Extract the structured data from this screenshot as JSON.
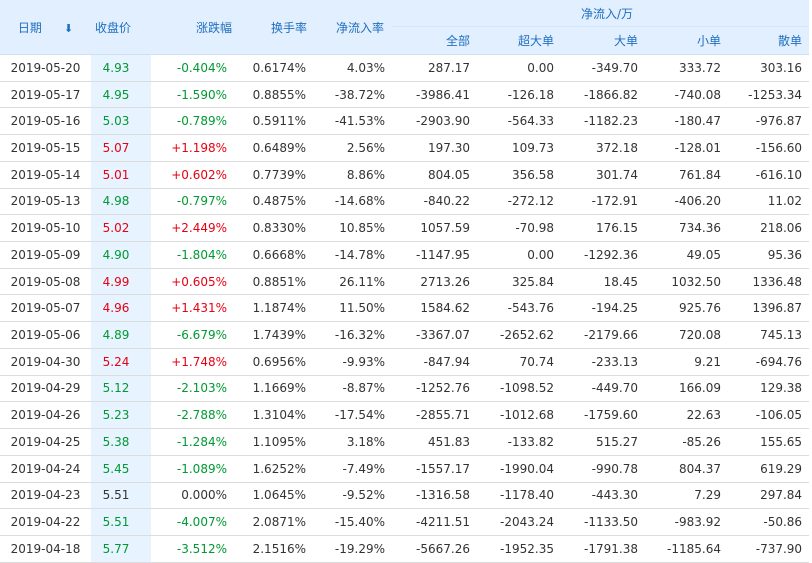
{
  "headers": {
    "date": "日期",
    "close": "收盘价",
    "change_pct": "涨跌幅",
    "turnover": "换手率",
    "net_inflow_rate": "净流入率",
    "net_inflow_group": "净流入/万",
    "all": "全部",
    "super_large": "超大单",
    "large": "大单",
    "small": "小单",
    "retail": "散单"
  },
  "colors": {
    "up": "#e60012",
    "down": "#009933",
    "flat": "#333333",
    "header_bg": "#e2efff",
    "header_text": "#1f6fbf",
    "close_col_bg": "#e7f3ff"
  },
  "sort_icon": "arrow-down-icon",
  "rows": [
    {
      "date": "2019-05-20",
      "close": "4.93",
      "change": "-0.404%",
      "turnover": "0.6174%",
      "rate": "4.03%",
      "all": "287.17",
      "super": "0.00",
      "large": "-349.70",
      "small": "333.72",
      "retail": "303.16",
      "dir": "down"
    },
    {
      "date": "2019-05-17",
      "close": "4.95",
      "change": "-1.590%",
      "turnover": "0.8855%",
      "rate": "-38.72%",
      "all": "-3986.41",
      "super": "-126.18",
      "large": "-1866.82",
      "small": "-740.08",
      "retail": "-1253.34",
      "dir": "down"
    },
    {
      "date": "2019-05-16",
      "close": "5.03",
      "change": "-0.789%",
      "turnover": "0.5911%",
      "rate": "-41.53%",
      "all": "-2903.90",
      "super": "-564.33",
      "large": "-1182.23",
      "small": "-180.47",
      "retail": "-976.87",
      "dir": "down"
    },
    {
      "date": "2019-05-15",
      "close": "5.07",
      "change": "+1.198%",
      "turnover": "0.6489%",
      "rate": "2.56%",
      "all": "197.30",
      "super": "109.73",
      "large": "372.18",
      "small": "-128.01",
      "retail": "-156.60",
      "dir": "up"
    },
    {
      "date": "2019-05-14",
      "close": "5.01",
      "change": "+0.602%",
      "turnover": "0.7739%",
      "rate": "8.86%",
      "all": "804.05",
      "super": "356.58",
      "large": "301.74",
      "small": "761.84",
      "retail": "-616.10",
      "dir": "up"
    },
    {
      "date": "2019-05-13",
      "close": "4.98",
      "change": "-0.797%",
      "turnover": "0.4875%",
      "rate": "-14.68%",
      "all": "-840.22",
      "super": "-272.12",
      "large": "-172.91",
      "small": "-406.20",
      "retail": "11.02",
      "dir": "down"
    },
    {
      "date": "2019-05-10",
      "close": "5.02",
      "change": "+2.449%",
      "turnover": "0.8330%",
      "rate": "10.85%",
      "all": "1057.59",
      "super": "-70.98",
      "large": "176.15",
      "small": "734.36",
      "retail": "218.06",
      "dir": "up"
    },
    {
      "date": "2019-05-09",
      "close": "4.90",
      "change": "-1.804%",
      "turnover": "0.6668%",
      "rate": "-14.78%",
      "all": "-1147.95",
      "super": "0.00",
      "large": "-1292.36",
      "small": "49.05",
      "retail": "95.36",
      "dir": "down"
    },
    {
      "date": "2019-05-08",
      "close": "4.99",
      "change": "+0.605%",
      "turnover": "0.8851%",
      "rate": "26.11%",
      "all": "2713.26",
      "super": "325.84",
      "large": "18.45",
      "small": "1032.50",
      "retail": "1336.48",
      "dir": "up"
    },
    {
      "date": "2019-05-07",
      "close": "4.96",
      "change": "+1.431%",
      "turnover": "1.1874%",
      "rate": "11.50%",
      "all": "1584.62",
      "super": "-543.76",
      "large": "-194.25",
      "small": "925.76",
      "retail": "1396.87",
      "dir": "up"
    },
    {
      "date": "2019-05-06",
      "close": "4.89",
      "change": "-6.679%",
      "turnover": "1.7439%",
      "rate": "-16.32%",
      "all": "-3367.07",
      "super": "-2652.62",
      "large": "-2179.66",
      "small": "720.08",
      "retail": "745.13",
      "dir": "down"
    },
    {
      "date": "2019-04-30",
      "close": "5.24",
      "change": "+1.748%",
      "turnover": "0.6956%",
      "rate": "-9.93%",
      "all": "-847.94",
      "super": "70.74",
      "large": "-233.13",
      "small": "9.21",
      "retail": "-694.76",
      "dir": "up"
    },
    {
      "date": "2019-04-29",
      "close": "5.12",
      "change": "-2.103%",
      "turnover": "1.1669%",
      "rate": "-8.87%",
      "all": "-1252.76",
      "super": "-1098.52",
      "large": "-449.70",
      "small": "166.09",
      "retail": "129.38",
      "dir": "down"
    },
    {
      "date": "2019-04-26",
      "close": "5.23",
      "change": "-2.788%",
      "turnover": "1.3104%",
      "rate": "-17.54%",
      "all": "-2855.71",
      "super": "-1012.68",
      "large": "-1759.60",
      "small": "22.63",
      "retail": "-106.05",
      "dir": "down"
    },
    {
      "date": "2019-04-25",
      "close": "5.38",
      "change": "-1.284%",
      "turnover": "1.1095%",
      "rate": "3.18%",
      "all": "451.83",
      "super": "-133.82",
      "large": "515.27",
      "small": "-85.26",
      "retail": "155.65",
      "dir": "down"
    },
    {
      "date": "2019-04-24",
      "close": "5.45",
      "change": "-1.089%",
      "turnover": "1.6252%",
      "rate": "-7.49%",
      "all": "-1557.17",
      "super": "-1990.04",
      "large": "-990.78",
      "small": "804.37",
      "retail": "619.29",
      "dir": "down"
    },
    {
      "date": "2019-04-23",
      "close": "5.51",
      "change": "0.000%",
      "turnover": "1.0645%",
      "rate": "-9.52%",
      "all": "-1316.58",
      "super": "-1178.40",
      "large": "-443.30",
      "small": "7.29",
      "retail": "297.84",
      "dir": "flat"
    },
    {
      "date": "2019-04-22",
      "close": "5.51",
      "change": "-4.007%",
      "turnover": "2.0871%",
      "rate": "-15.40%",
      "all": "-4211.51",
      "super": "-2043.24",
      "large": "-1133.50",
      "small": "-983.92",
      "retail": "-50.86",
      "dir": "down"
    },
    {
      "date": "2019-04-18",
      "close": "5.77",
      "change": "-3.512%",
      "turnover": "2.1516%",
      "rate": "-19.29%",
      "all": "-5667.26",
      "super": "-1952.35",
      "large": "-1791.38",
      "small": "-1185.64",
      "retail": "-737.90",
      "dir": "down"
    }
  ]
}
